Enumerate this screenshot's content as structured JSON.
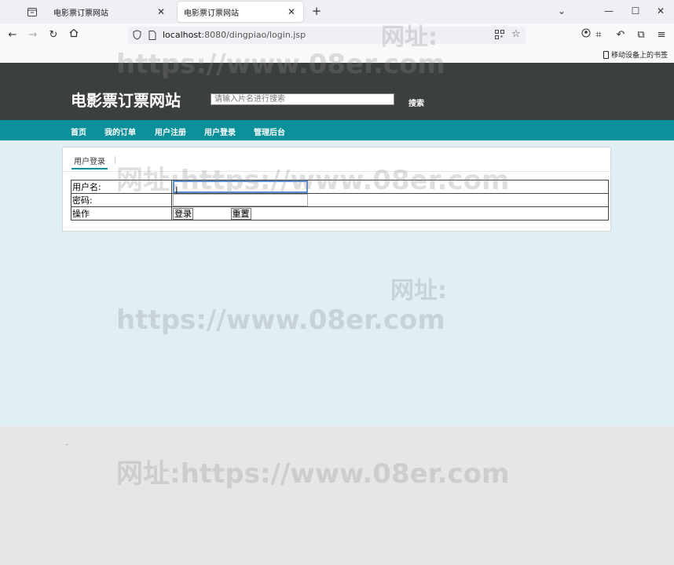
{
  "browser": {
    "tabs": [
      {
        "title": "电影票订票网站",
        "active": false
      },
      {
        "title": "电影票订票网站",
        "active": true
      }
    ],
    "url_host": "localhost",
    "url_rest": ":8080/dingpiao/login.jsp",
    "bookmark_label": "移动设备上的书签"
  },
  "site": {
    "logo": "电影票订票网站",
    "search_placeholder": "请输入片名进行搜索",
    "search_button": "搜索",
    "nav": [
      "首页",
      "我的订单",
      "用户注册",
      "用户登录",
      "管理后台"
    ]
  },
  "login": {
    "panel_tab": "用户登录",
    "username_label": "用户名:",
    "password_label": "密码:",
    "action_label": "操作",
    "login_button": "登录",
    "reset_button": "重置"
  },
  "watermark": {
    "cn_label": "网址:",
    "url": "https://www.08er.com",
    "full": "网址:https://www.08er.com"
  }
}
